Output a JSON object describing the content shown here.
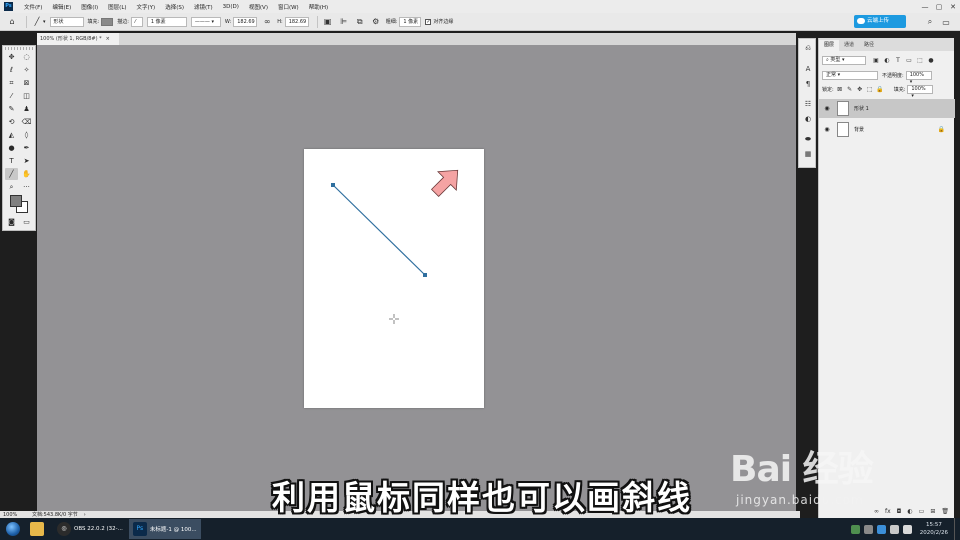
{
  "menubar": {
    "logo": "Ps",
    "items": [
      "文件(F)",
      "编辑(E)",
      "图像(I)",
      "图层(L)",
      "文字(Y)",
      "选择(S)",
      "滤镜(T)",
      "3D(D)",
      "视图(V)",
      "窗口(W)",
      "帮助(H)"
    ],
    "window_controls": [
      "—",
      "▢",
      "✕"
    ]
  },
  "optbar": {
    "mode": "形状",
    "fill_label": "填充:",
    "stroke_label": "描边:",
    "stroke_width": "1 像素",
    "w_label": "W:",
    "w_value": "182.69",
    "h_label": "H:",
    "h_value": "182.69",
    "weight_label": "粗细:",
    "weight_value": "1 像素",
    "align_edges": "对齐边缘",
    "cloud_button": "云端上传"
  },
  "document": {
    "tab_title": "100% (形状 1, RGB/8#) *",
    "tab_close": "×"
  },
  "layers_panel": {
    "tabs": [
      "图层",
      "通道",
      "路径"
    ],
    "filter_kind": "类型",
    "blend_mode": "正常",
    "opacity_label": "不透明度:",
    "opacity_value": "100%",
    "lock_label": "锁定:",
    "fill_label": "填充:",
    "fill_value": "100%",
    "layers": [
      {
        "name": "形状 1",
        "selected": true
      },
      {
        "name": "背景",
        "selected": false,
        "locked": true
      }
    ]
  },
  "statusbar": {
    "zoom": "100%",
    "doc_info": "文档:543.8K/0 字节"
  },
  "taskbar": {
    "apps": [
      {
        "label": "OBS 22.0.2 (32-...",
        "icon": "obs-icon"
      },
      {
        "label": "未标题-1 @ 100...",
        "icon": "photoshop-icon"
      }
    ],
    "time": "15:57",
    "date": "2020/2/26"
  },
  "subtitle": "利用鼠标同样也可以画斜线",
  "watermark": {
    "brand": "Bai 经验",
    "site": "jingyan.baidu.com"
  },
  "colors": {
    "accent": "#1d9ae0",
    "canvas_bg": "#939295",
    "line": "#2f6f9f",
    "arrow": "#f5a3a3"
  }
}
